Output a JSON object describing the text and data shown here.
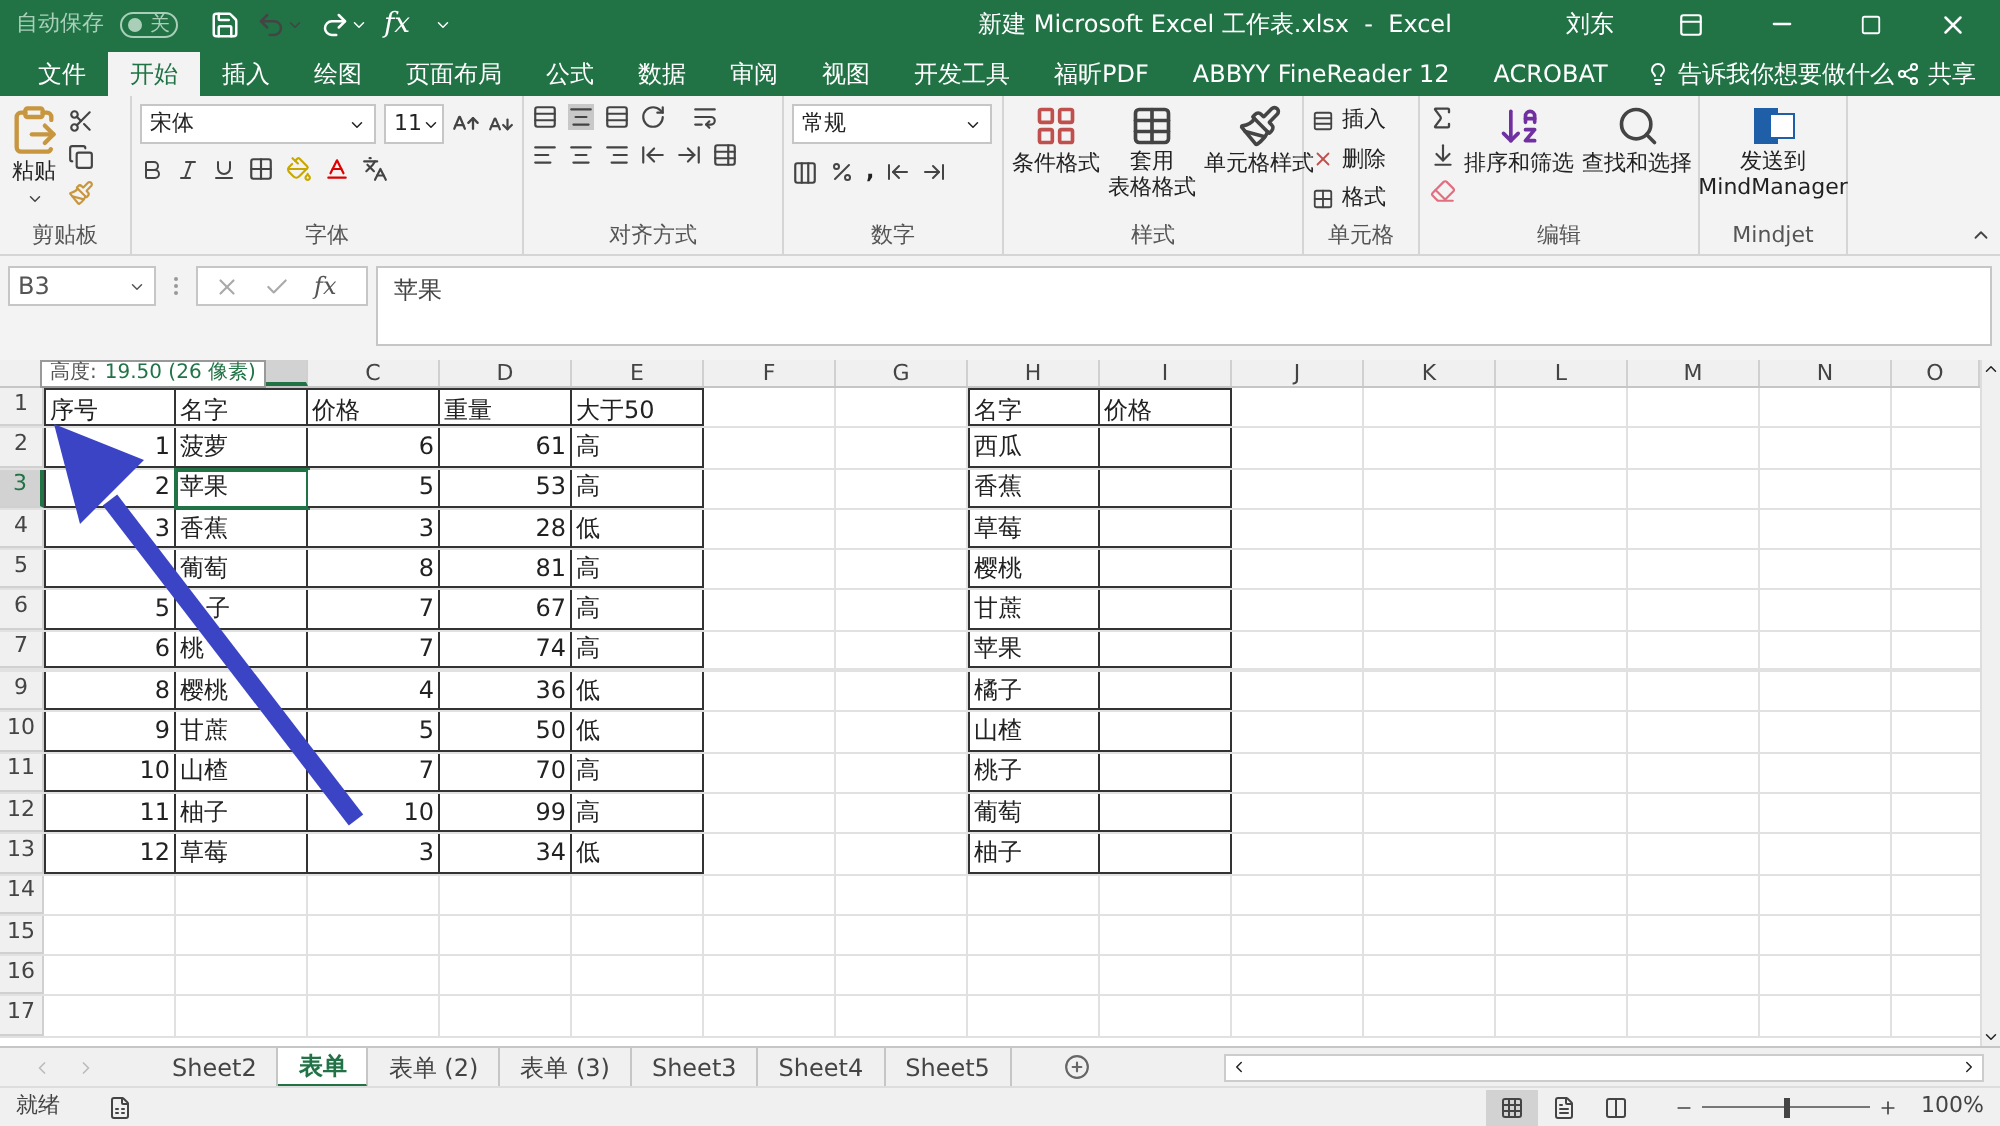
{
  "quick_access": {
    "autosave_label": "自动保存",
    "autosave_on": false,
    "autosave_state": "关",
    "fx": "fx"
  },
  "window": {
    "title": "新建 Microsoft Excel 工作表.xlsx  -  Excel",
    "user": "刘东"
  },
  "ribbon_tabs": [
    {
      "label": "文件",
      "selected": false
    },
    {
      "label": "开始",
      "selected": true
    },
    {
      "label": "插入",
      "selected": false
    },
    {
      "label": "绘图",
      "selected": false
    },
    {
      "label": "页面布局",
      "selected": false
    },
    {
      "label": "公式",
      "selected": false
    },
    {
      "label": "数据",
      "selected": false
    },
    {
      "label": "审阅",
      "selected": false
    },
    {
      "label": "视图",
      "selected": false
    },
    {
      "label": "开发工具",
      "selected": false
    },
    {
      "label": "福昕PDF",
      "selected": false
    },
    {
      "label": "ABBYY FineReader 12",
      "selected": false
    },
    {
      "label": "ACROBAT",
      "selected": false
    }
  ],
  "tell_me": "告诉我你想要做什么",
  "share": "共享",
  "ribbon": {
    "paste": "粘贴",
    "font_name": "宋体",
    "font_size": "11",
    "number_format": "常规",
    "comma": ",",
    "conditional_format": "条件格式",
    "table_format": [
      "套用",
      "表格格式"
    ],
    "cell_styles": "单元格样式",
    "insert": "插入",
    "delete": "删除",
    "format": "格式",
    "sort_filter": "排序和筛选",
    "find_select": "查找和选择",
    "send_to": [
      "发送到",
      "MindManager"
    ],
    "groups": [
      "剪贴板",
      "字体",
      "对齐方式",
      "数字",
      "样式",
      "单元格",
      "编辑",
      "Mindjet"
    ]
  },
  "formula_bar": {
    "name_box": "B3",
    "fx": "fx",
    "value": "苹果"
  },
  "tooltip": {
    "label": "高度:",
    "value": "19.50 (26 像素)"
  },
  "columns": [
    {
      "selected": true
    },
    {
      "label": "C",
      "selected": false
    },
    {
      "label": "D",
      "selected": false
    },
    {
      "label": "E",
      "selected": false
    },
    {
      "label": "F",
      "selected": false
    },
    {
      "label": "G",
      "selected": false
    },
    {
      "label": "H",
      "selected": false
    },
    {
      "label": "I",
      "selected": false
    },
    {
      "label": "J",
      "selected": false
    },
    {
      "label": "K",
      "selected": false
    },
    {
      "label": "L",
      "selected": false
    },
    {
      "label": "M",
      "selected": false
    },
    {
      "label": "N",
      "selected": false
    },
    {
      "label": "O",
      "selected": false
    }
  ],
  "rows": [
    {
      "label": "1",
      "selected": false
    },
    {
      "label": "2",
      "selected": false
    },
    {
      "label": "3",
      "selected": true
    },
    {
      "label": "4",
      "selected": false
    },
    {
      "label": "5",
      "selected": false
    },
    {
      "label": "6",
      "selected": false
    },
    {
      "label": "7",
      "selected": false
    },
    {
      "label": "9",
      "selected": false
    },
    {
      "label": "10",
      "selected": false
    },
    {
      "label": "11",
      "selected": false
    },
    {
      "label": "12",
      "selected": false
    },
    {
      "label": "13",
      "selected": false
    },
    {
      "label": "14",
      "selected": false
    },
    {
      "label": "15",
      "selected": false
    },
    {
      "label": "16",
      "selected": false
    },
    {
      "label": "17",
      "selected": false
    }
  ],
  "left_table": {
    "headers": [
      "序号",
      "名字",
      "价格",
      "重量",
      "大于50"
    ],
    "rows": [
      {
        "no": "1",
        "name": "菠萝",
        "price": "6",
        "weight": "61",
        "over50": "高"
      },
      {
        "no": "2",
        "name": "苹果",
        "price": "5",
        "weight": "53",
        "over50": "高"
      },
      {
        "no": "3",
        "name": "香蕉",
        "price": "3",
        "weight": "28",
        "over50": "低"
      },
      {
        "name": "葡萄",
        "price": "8",
        "weight": "81",
        "over50": "高"
      },
      {
        "no": "5",
        "name": "子",
        "kind": "cut_left",
        "price": "7",
        "weight": "67",
        "over50": "高"
      },
      {
        "no": "6",
        "name": "桃",
        "price": "7",
        "weight": "74",
        "over50": "高"
      },
      {
        "no": "8",
        "name": "樱桃",
        "price": "4",
        "weight": "36",
        "over50": "低"
      },
      {
        "no": "9",
        "name": "甘蔗",
        "price": "5",
        "weight": "50",
        "over50": "低"
      },
      {
        "no": "10",
        "name": "山楂",
        "price": "7",
        "weight": "70",
        "over50": "高"
      },
      {
        "no": "11",
        "name": "柚子",
        "price": "10",
        "weight": "99",
        "over50": "高"
      },
      {
        "no": "12",
        "name": "草莓",
        "price": "3",
        "weight": "34",
        "over50": "低"
      }
    ]
  },
  "right_table": {
    "headers": [
      "名字",
      "价格"
    ],
    "rows": [
      {
        "name": "西瓜"
      },
      {
        "name": "香蕉"
      },
      {
        "name": "草莓"
      },
      {
        "name": "樱桃"
      },
      {
        "name": "甘蔗"
      },
      {
        "name": "苹果"
      },
      {
        "name": "橘子"
      },
      {
        "name": "山楂"
      },
      {
        "name": "桃子"
      },
      {
        "name": "葡萄"
      },
      {
        "name": "柚子"
      }
    ]
  },
  "sheet_tabs": [
    {
      "label": "Sheet2",
      "selected": false
    },
    {
      "label": "表单",
      "selected": true
    },
    {
      "label": "表单 (2)",
      "selected": false
    },
    {
      "label": "表单 (3)",
      "selected": false
    },
    {
      "label": "Sheet3",
      "selected": false
    },
    {
      "label": "Sheet4",
      "selected": false
    },
    {
      "label": "Sheet5",
      "selected": false
    }
  ],
  "status": {
    "text": "就绪",
    "zoom": "100%",
    "level": 0.5
  },
  "views": [
    {
      "kind": "normal",
      "selected": true
    },
    {
      "kind": "page_layout",
      "selected": false
    },
    {
      "kind": "page_break",
      "selected": false
    }
  ]
}
